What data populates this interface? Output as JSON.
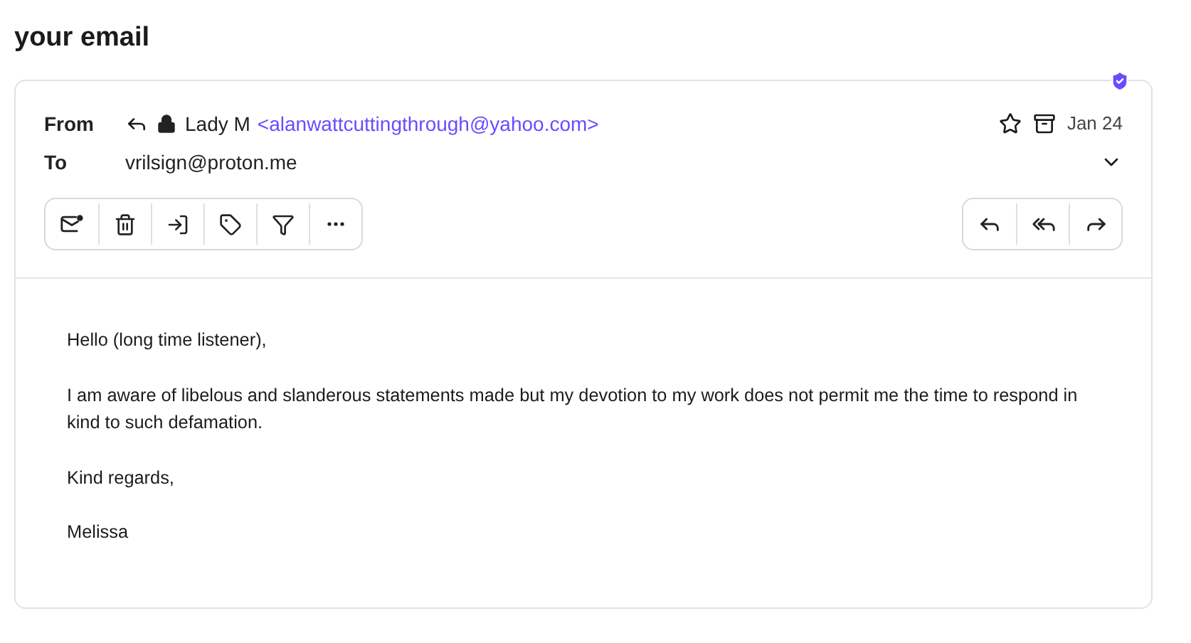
{
  "page_title": "your email",
  "message": {
    "from_label": "From",
    "sender_name": "Lady M",
    "sender_address": "<alanwattcuttingthrough@yahoo.com>",
    "to_label": "To",
    "recipient": "vrilsign@proton.me",
    "starred": false,
    "date": "Jan 24",
    "verified": true,
    "body": [
      "Hello (long time listener),",
      "I am aware of libelous and slanderous statements made but my devotion to my work does not permit me the time to respond in kind to such defamation.",
      "Kind regards,",
      "Melissa"
    ]
  }
}
